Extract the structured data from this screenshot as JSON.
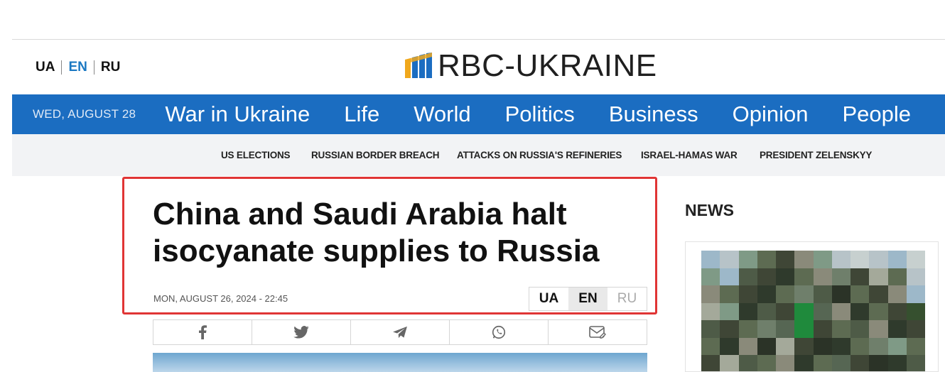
{
  "header": {
    "languages": [
      {
        "code": "UA",
        "active": false
      },
      {
        "code": "EN",
        "active": true
      },
      {
        "code": "RU",
        "active": false
      }
    ],
    "logo_text": "RBC-UKRAINE"
  },
  "nav": {
    "date": "WED, AUGUST 28",
    "items": [
      "War in Ukraine",
      "Life",
      "World",
      "Politics",
      "Business",
      "Opinion",
      "People"
    ]
  },
  "tags": [
    "US ELECTIONS",
    "RUSSIAN BORDER BREACH",
    "ATTACKS ON RUSSIA'S REFINERIES",
    "ISRAEL-HAMAS WAR",
    "PRESIDENT ZELENSKYY"
  ],
  "article": {
    "headline_line1": "China and Saudi Arabia halt",
    "headline_line2": "isocyanate supplies to Russia",
    "published": "MON, AUGUST 26, 2024 - 22:45",
    "language_switch": [
      "UA",
      "EN",
      "RU"
    ],
    "share_icons": [
      "facebook-icon",
      "twitter-icon",
      "telegram-icon",
      "whatsapp-icon",
      "email-icon"
    ]
  },
  "sidebar": {
    "news_title": "NEWS"
  },
  "colors": {
    "nav_blue": "#1b6dc1",
    "accent_blue": "#1a78c2",
    "highlight_red": "#e03535",
    "tag_bar_gray": "#f2f3f5"
  }
}
